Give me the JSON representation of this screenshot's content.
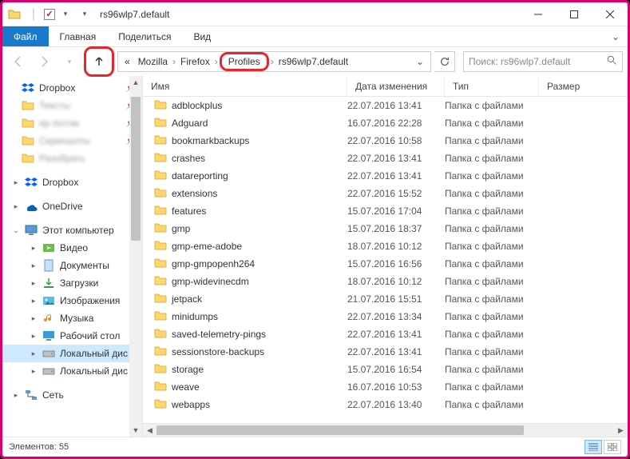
{
  "window": {
    "title": "rs96wlp7.default",
    "qat_check": "✓"
  },
  "ribbon": {
    "file": "Файл",
    "home": "Главная",
    "share": "Поделиться",
    "view": "Вид"
  },
  "breadcrumbs": {
    "overflow": "«",
    "items": [
      "Mozilla",
      "Firefox",
      "Profiles",
      "rs96wlp7.default"
    ]
  },
  "search": {
    "placeholder": "Поиск: rs96wlp7.default"
  },
  "columns": {
    "name": "Имя",
    "date": "Дата изменения",
    "type": "Тип",
    "size": "Размер"
  },
  "sidebar": {
    "quick": [
      {
        "label": "Dropbox",
        "pin": true,
        "icon": "dropbox",
        "blur": false
      },
      {
        "label": "Тексты",
        "pin": true,
        "icon": "folder",
        "blur": true
      },
      {
        "label": "яр потом",
        "pin": true,
        "icon": "folder",
        "blur": true
      },
      {
        "label": "Скриншоты",
        "pin": true,
        "icon": "folder",
        "blur": true
      },
      {
        "label": "Разобрать",
        "pin": false,
        "icon": "folder",
        "blur": true
      }
    ],
    "dropbox": "Dropbox",
    "onedrive": "OneDrive",
    "thispc": "Этот компьютер",
    "pc": [
      {
        "label": "Видео",
        "icon": "video"
      },
      {
        "label": "Документы",
        "icon": "docs"
      },
      {
        "label": "Загрузки",
        "icon": "downloads"
      },
      {
        "label": "Изображения",
        "icon": "pictures"
      },
      {
        "label": "Музыка",
        "icon": "music"
      },
      {
        "label": "Рабочий стол",
        "icon": "desktop"
      },
      {
        "label": "Локальный дис",
        "icon": "drive",
        "sel": true
      },
      {
        "label": "Локальный дис",
        "icon": "drive"
      }
    ],
    "network": "Сеть"
  },
  "type_folder": "Папка с файлами",
  "files": [
    {
      "name": "adblockplus",
      "date": "22.07.2016 13:41"
    },
    {
      "name": "Adguard",
      "date": "16.07.2016 22:28"
    },
    {
      "name": "bookmarkbackups",
      "date": "22.07.2016 10:58"
    },
    {
      "name": "crashes",
      "date": "22.07.2016 13:41"
    },
    {
      "name": "datareporting",
      "date": "22.07.2016 13:41"
    },
    {
      "name": "extensions",
      "date": "22.07.2016 15:52"
    },
    {
      "name": "features",
      "date": "15.07.2016 17:04"
    },
    {
      "name": "gmp",
      "date": "15.07.2016 18:37"
    },
    {
      "name": "gmp-eme-adobe",
      "date": "18.07.2016 10:12"
    },
    {
      "name": "gmp-gmpopenh264",
      "date": "15.07.2016 16:56"
    },
    {
      "name": "gmp-widevinecdm",
      "date": "18.07.2016 10:12"
    },
    {
      "name": "jetpack",
      "date": "21.07.2016 15:51"
    },
    {
      "name": "minidumps",
      "date": "22.07.2016 13:34"
    },
    {
      "name": "saved-telemetry-pings",
      "date": "22.07.2016 13:41"
    },
    {
      "name": "sessionstore-backups",
      "date": "22.07.2016 13:41"
    },
    {
      "name": "storage",
      "date": "15.07.2016 16:54"
    },
    {
      "name": "weave",
      "date": "16.07.2016 10:53"
    },
    {
      "name": "webapps",
      "date": "22.07.2016 13:40"
    }
  ],
  "status": {
    "count_label": "Элементов: 55"
  }
}
